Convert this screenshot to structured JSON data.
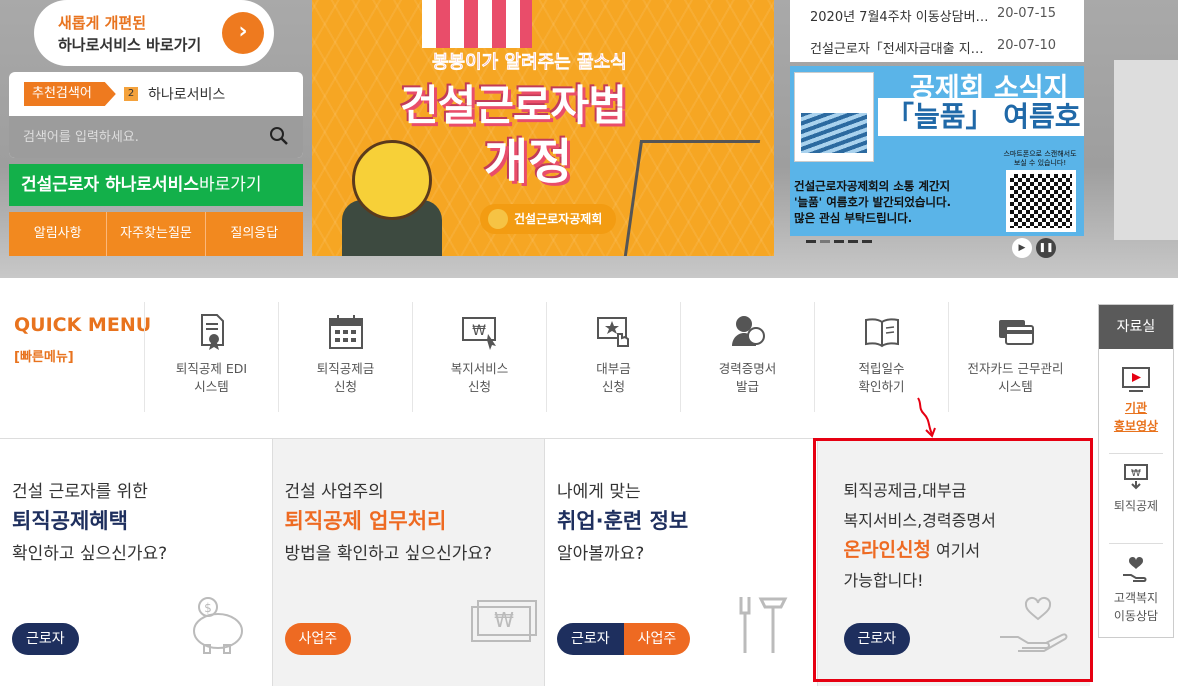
{
  "promo": {
    "line1": "새롭게 개편된",
    "line2": "하나로서비스 바로가기"
  },
  "search": {
    "rec_label": "추천검색어",
    "rec_rank": "2",
    "rec_keyword": "하나로서비스",
    "placeholder": "검색어를 입력하세요."
  },
  "green_link": {
    "bold": "건설근로자 하나로서비스",
    "thin": "바로가기"
  },
  "quick_tabs": [
    "알림사항",
    "자주찾는질문",
    "질의응답"
  ],
  "banner": {
    "sub": "봉봉이가 알려주는 꿀소식",
    "title1": "건설근로자법",
    "title2": "개정",
    "logo": "건설근로자공제회"
  },
  "news": [
    {
      "title": "2020년 7월4주차 이동상담버…",
      "date": "20-07-15"
    },
    {
      "title": "건설근로자「전세자금대출 지…",
      "date": "20-07-10"
    }
  ],
  "ad": {
    "title1": "공제회 소식지",
    "title2": "「늘품」 여름호",
    "qr_text": "스마트폰으로 스캔해서도 보실 수 있습니다!",
    "desc1": "건설근로자공제회의 소통 계간지",
    "desc2": "'늘품' 여름호가 발간되었습니다.",
    "desc3": "많은 관심 부탁드립니다."
  },
  "quick_menu": {
    "title": "QUICK MENU",
    "subtitle": "[빠른메뉴]",
    "items": [
      {
        "label": "퇴직공제 EDI\n시스템",
        "icon": "document-certificate-icon"
      },
      {
        "label": "퇴직공제금\n신청",
        "icon": "calendar-icon"
      },
      {
        "label": "복지서비스\n신청",
        "icon": "won-monitor-icon"
      },
      {
        "label": "대부금\n신청",
        "icon": "star-click-icon"
      },
      {
        "label": "경력증명서\n발급",
        "icon": "worker-icon"
      },
      {
        "label": "적립일수\n확인하기",
        "icon": "open-book-icon"
      },
      {
        "label": "전자카드 근무관리\n시스템",
        "icon": "card-icon"
      }
    ]
  },
  "side": {
    "header": "자료실",
    "item1a": "기관",
    "item1b": "홍보영상",
    "item2": "퇴직공제",
    "item3a": "고객복지",
    "item3b": "이동상담"
  },
  "cards": [
    {
      "l1": "건설 근로자를 위한",
      "l2": "퇴직공제혜택",
      "l3": "확인하고 싶으신가요?",
      "btns": [
        "근로자"
      ]
    },
    {
      "l1": "건설 사업주의",
      "l2": "퇴직공제 업무처리",
      "l3": "방법을 확인하고 싶으신가요?",
      "btns": [
        "사업주"
      ]
    },
    {
      "l1": "나에게 맞는",
      "l2": "취업·훈련 정보",
      "l3": "알아볼까요?",
      "btns": [
        "근로자",
        "사업주"
      ]
    },
    {
      "t1": "퇴직공제금,대부금",
      "t2": "복지서비스,경력증명서",
      "t3a": "온라인신청",
      "t3b": " 여기서",
      "t4": "가능합니다!",
      "btns": [
        "근로자"
      ]
    }
  ],
  "colors": {
    "orange": "#ee7a1f",
    "navy": "#1e2f5e",
    "green": "#13b04a",
    "highlight": "#e60012"
  }
}
